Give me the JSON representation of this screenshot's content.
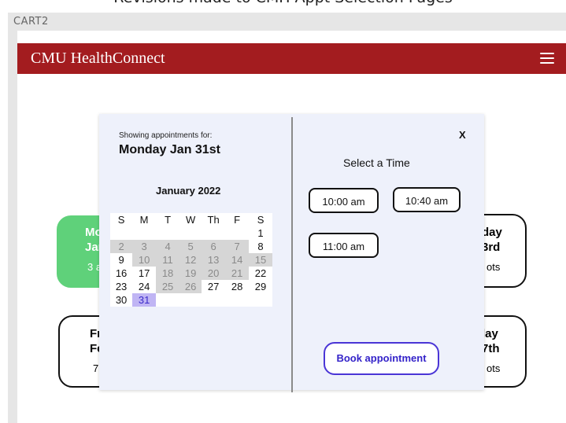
{
  "caption": "Revisions made to CMH Appt Selection Pages",
  "frame_label": "CART2",
  "header": {
    "title": "CMU HealthConnect"
  },
  "cards": {
    "left_top": {
      "title1": "Mo",
      "title2": "Jar",
      "sub": "3 a"
    },
    "right_top": {
      "title1": "day",
      "title2": "3rd",
      "sub": "ots"
    },
    "left_bottom": {
      "title1": "Fr",
      "title2": "Fe",
      "sub": "7 a"
    },
    "right_bottom": {
      "title1": "lay",
      "title2": "7th",
      "sub": "ots"
    }
  },
  "modal": {
    "showing_label": "Showing appointments for:",
    "selected_date": "Monday Jan 31st",
    "month_label": "January 2022",
    "weekdays": [
      "S",
      "M",
      "T",
      "W",
      "Th",
      "F",
      "S"
    ],
    "weeks": [
      [
        {
          "d": "",
          "s": "empty"
        },
        {
          "d": "",
          "s": "empty"
        },
        {
          "d": "",
          "s": "empty"
        },
        {
          "d": "",
          "s": "empty"
        },
        {
          "d": "",
          "s": "empty"
        },
        {
          "d": "",
          "s": "empty"
        },
        {
          "d": "1",
          "s": "avail"
        }
      ],
      [
        {
          "d": "2",
          "s": "dis"
        },
        {
          "d": "3",
          "s": "dis"
        },
        {
          "d": "4",
          "s": "dis"
        },
        {
          "d": "5",
          "s": "dis"
        },
        {
          "d": "6",
          "s": "dis"
        },
        {
          "d": "7",
          "s": "dis"
        },
        {
          "d": "8",
          "s": "avail"
        }
      ],
      [
        {
          "d": "9",
          "s": "avail"
        },
        {
          "d": "10",
          "s": "dis"
        },
        {
          "d": "11",
          "s": "dis"
        },
        {
          "d": "12",
          "s": "dis"
        },
        {
          "d": "13",
          "s": "dis"
        },
        {
          "d": "14",
          "s": "dis"
        },
        {
          "d": "15",
          "s": "dis"
        }
      ],
      [
        {
          "d": "16",
          "s": "avail"
        },
        {
          "d": "17",
          "s": "avail"
        },
        {
          "d": "18",
          "s": "dis"
        },
        {
          "d": "19",
          "s": "dis"
        },
        {
          "d": "20",
          "s": "dis"
        },
        {
          "d": "21",
          "s": "dis"
        },
        {
          "d": "22",
          "s": "avail"
        }
      ],
      [
        {
          "d": "23",
          "s": "avail"
        },
        {
          "d": "24",
          "s": "avail"
        },
        {
          "d": "25",
          "s": "dis"
        },
        {
          "d": "26",
          "s": "dis"
        },
        {
          "d": "27",
          "s": "avail"
        },
        {
          "d": "28",
          "s": "avail"
        },
        {
          "d": "29",
          "s": "avail"
        }
      ],
      [
        {
          "d": "30",
          "s": "avail"
        },
        {
          "d": "31",
          "s": "sel"
        },
        {
          "d": "",
          "s": "empty"
        },
        {
          "d": "",
          "s": "empty"
        },
        {
          "d": "",
          "s": "empty"
        },
        {
          "d": "",
          "s": "empty"
        },
        {
          "d": "",
          "s": "empty"
        }
      ]
    ],
    "close_label": "X",
    "time_heading": "Select a Time",
    "time_slots": [
      "10:00 am",
      "10:40 am",
      "11:00 am"
    ],
    "book_label": "Book appointment"
  },
  "colors": {
    "header": "#a31c1f",
    "green_card": "#5fd17a",
    "selected_day": "#c0b5f4",
    "book_border": "#4a35d6"
  }
}
